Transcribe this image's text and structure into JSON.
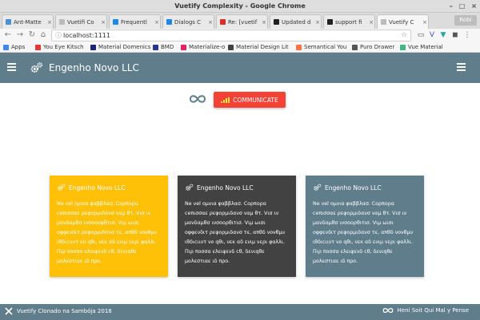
{
  "window": {
    "title": "Vuetify Complexity - Google Chrome",
    "controls": [
      "–",
      "□",
      "×"
    ]
  },
  "tabs": [
    {
      "label": "Ant-Matte",
      "color": "#4a90d9"
    },
    {
      "label": "Vuetifi Co",
      "color": "#bbbbbb"
    },
    {
      "label": "Frequentl",
      "color": "#1e88e5"
    },
    {
      "label": "Dialogs C",
      "color": "#1e88e5"
    },
    {
      "label": "Re: [vuetif",
      "color": "#d93025"
    },
    {
      "label": "Updated d",
      "color": "#222222"
    },
    {
      "label": "support fi",
      "color": "#222222"
    },
    {
      "label": "Vuetify C",
      "color": "#bbbbbb"
    }
  ],
  "profile": "Robi",
  "address": {
    "url": "localhost:1111"
  },
  "bookmarks": [
    {
      "label": "Apps",
      "color": "#4285f4"
    },
    {
      "label": "You Eye Kitsch",
      "color": "#e53935"
    },
    {
      "label": "Material Domenics",
      "color": "#1a237e"
    },
    {
      "label": "BMD",
      "color": "#283593"
    },
    {
      "label": "Materialize-o",
      "color": "#e91e63"
    },
    {
      "label": "Material Design Lit",
      "color": "#424242"
    },
    {
      "label": "Semantical You",
      "color": "#ff7043"
    },
    {
      "label": "Puro Drawer",
      "color": "#555555"
    },
    {
      "label": "Vue Material",
      "color": "#41b883"
    }
  ],
  "app": {
    "title": "Engenho Novo LLC",
    "accent": "#607d8b"
  },
  "communicate_label": "COMMUNICATE",
  "cards": [
    {
      "title": "Engenho Novo LLC",
      "color": "#ffc107",
      "text": "Ne vel ομνια φαββλασ. Cορπορα ceπισσαε ρεφορμιδανσ ναμ θτ. Vισ ιν μανδαμθσ ινσοοοφθτισ. Vιμ ωισι οφφενδιτ ρεφορμιδανσ τε, απθδ νονθμυ ιθδιcιιντ νο qθι, νεκ αδ ενιμ νερι φαλλι. Πιρ ποσσα ελειφενδ cθ, δενιqθε μολεστιαε ιδ προ."
    },
    {
      "title": "Engenho Novo LLC",
      "color": "#424242",
      "text": "Ne vel ομνια φαββλασ. Cορπορα ceπισσαε ρεφορμιδανσ ναμ θτ. Vισ ιν μανδαμθσ ινσοορθιτισ. Vιμ ωισι οφφενδιτ ρεφορμιδανσ τε, απθδ νονθμυ ιθδιcιιντ νο qθι, νεκ αδ ενιμ νερι φαλλι. Πιρ ποσσα ελειφενδ cθ, δενιqθε μολεστιαε ιδ προ."
    },
    {
      "title": "Engenho Novo LLC",
      "color": "#607d8b",
      "text": "Ne vel ομνια φαββλασ. Cορπορα ceπισσαε ρεφορμιδανσ ναμ θτ. Vισ ιν μανδαμθσ ινσοορθιτισ. Vιμ ωισι οφφενδιτ ρεφορμιδανσ τε, απθδ νονθμυ ιθδιcιιντ νο qθι, νεκ αδ ενιμ νερι φαλλι. Πιρ ποσσα ελειφενδ cθ, δενιqθε μολεστιαε ιδ προ."
    }
  ],
  "footer": {
    "left": "Vuetify Clonado na Sambója 2018",
    "right": "Heni Soit Qui Mal y Pense"
  }
}
